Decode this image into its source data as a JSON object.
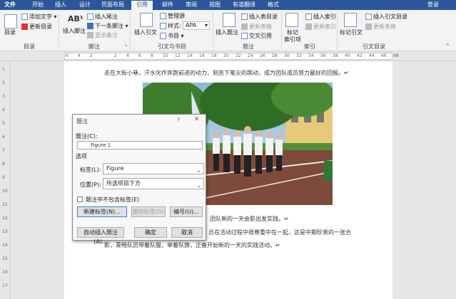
{
  "tabs": [
    {
      "label": "文件"
    },
    {
      "label": "开始"
    },
    {
      "label": "插入"
    },
    {
      "label": "设计"
    },
    {
      "label": "页面布局"
    },
    {
      "label": "引用"
    },
    {
      "label": "邮件"
    },
    {
      "label": "审阅"
    },
    {
      "label": "视图"
    },
    {
      "label": "有道翻译"
    },
    {
      "label": "格式"
    }
  ],
  "login_label": "登录",
  "ribbon": {
    "toc": {
      "big": "目录",
      "add_text": "添加文字 ▾",
      "update": "更新目录",
      "group": "目录"
    },
    "footnote": {
      "insert_footnote": "插入脚注",
      "insert_endnote": "插入尾注",
      "next_footnote": "下一条脚注 ▾",
      "show_notes": "显示备注",
      "group": "脚注"
    },
    "citation": {
      "insert_citation": "插入引文",
      "manage_sources": "管理源",
      "style_label": "样式:",
      "style_value": "APA",
      "bibliography": "书目 ▾",
      "group": "引文与书目"
    },
    "caption": {
      "insert_caption": "插入题注",
      "insert_table_of_figures": "插入表目录",
      "update_table": "更新表格",
      "cross_reference": "交叉引用",
      "group": "题注"
    },
    "index": {
      "mark_entry": "标记",
      "mark_entry2": "索引项",
      "insert_index": "插入索引",
      "update_index": "更新索引",
      "group": "索引"
    },
    "authorities": {
      "mark_citation": "标记引文",
      "insert_toa": "插入引文目录",
      "update_table": "更新表格",
      "group": "引文目录"
    }
  },
  "ruler_ticks": [
    "6",
    "4",
    "2",
    "",
    "2",
    "4",
    "6",
    "8",
    "10",
    "12",
    "14",
    "16",
    "18",
    "20",
    "22",
    "24",
    "26",
    "28",
    "30",
    "32",
    "34",
    "36",
    "38",
    "40",
    "42",
    "44",
    "46",
    "48"
  ],
  "vruler_ticks": [
    "1",
    "2",
    "3",
    "4",
    "5",
    "6",
    "7",
    "8",
    "9",
    "10",
    "11",
    "12",
    "13",
    "14",
    "15",
    "16",
    "17"
  ],
  "document": {
    "line1": "走在大街小巷，汗水化作奔跑前进的动力，刻苦下笔尖的跳动，成为团队成员努力最好的回报。↵",
    "line2": "团队新的一天会影出发实践。↵",
    "line3": "员在活动过程中很尊重中在一起，这是中期珍贵的一张合",
    "line4": "影，青畅队员带着队服，举着队旗，正备开始新的一天的实践活动。↵"
  },
  "dialog": {
    "title": "题注",
    "help": "?",
    "close": "✕",
    "caption_label": "题注(C):",
    "caption_value": "Figure 1",
    "options_label": "选项",
    "label_label": "标签(L):",
    "label_value": "Figure",
    "position_label": "位置(P):",
    "position_value": "所选项目下方",
    "exclude_label": "题注中不包含标签(E)",
    "new_label_button": "新建标签(N)...",
    "delete_label_button": "删除标签(D)",
    "numbering_button": "编号(U)...",
    "autocaption_button": "自动插入题注(A)...",
    "ok_button": "确定",
    "cancel_button": "取消"
  }
}
